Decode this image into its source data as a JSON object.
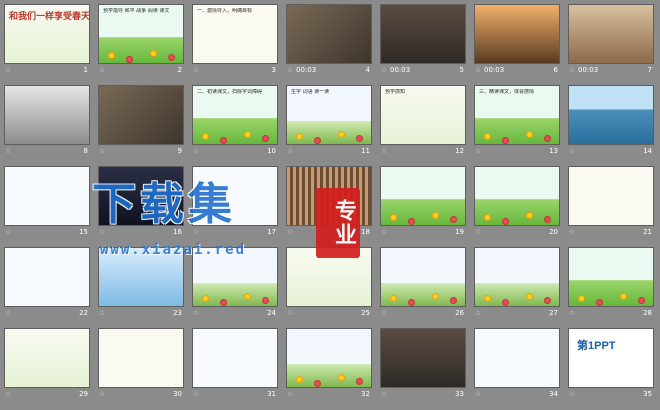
{
  "slides": [
    {
      "n": "1",
      "theme": "t-green",
      "title": "和我们一样享受春天",
      "dur": ""
    },
    {
      "n": "2",
      "theme": "t-grass",
      "text": "预学指导 和平 战争 阅读 课文",
      "dur": ""
    },
    {
      "n": "3",
      "theme": "t-cream",
      "text": "一、激情导入，明确目标",
      "dur": ""
    },
    {
      "n": "4",
      "theme": "t-photo",
      "text": "",
      "dur": "00:03"
    },
    {
      "n": "5",
      "theme": "t-dark",
      "text": "",
      "dur": "00:03"
    },
    {
      "n": "6",
      "theme": "t-dusk",
      "text": "",
      "dur": "00:03"
    },
    {
      "n": "7",
      "theme": "t-brick",
      "text": "",
      "dur": "00:03"
    },
    {
      "n": "8",
      "theme": "t-bw",
      "text": "",
      "dur": ""
    },
    {
      "n": "9",
      "theme": "t-photo",
      "text": "",
      "dur": ""
    },
    {
      "n": "10",
      "theme": "t-grass",
      "text": "二、初读课文，扫除字词障碍",
      "dur": ""
    },
    {
      "n": "11",
      "theme": "t-flower",
      "text": "生字 词语 读一读",
      "dur": ""
    },
    {
      "n": "12",
      "theme": "t-green",
      "text": "预学感知",
      "dur": ""
    },
    {
      "n": "13",
      "theme": "t-grass",
      "text": "三、精读课文，体会感情",
      "dur": ""
    },
    {
      "n": "14",
      "theme": "t-sea",
      "text": "",
      "dur": ""
    },
    {
      "n": "15",
      "theme": "t-white",
      "text": "",
      "dur": ""
    },
    {
      "n": "16",
      "theme": "t-night",
      "text": "",
      "dur": ""
    },
    {
      "n": "17",
      "theme": "t-white",
      "text": "",
      "dur": ""
    },
    {
      "n": "18",
      "theme": "t-crowd",
      "text": "",
      "dur": ""
    },
    {
      "n": "19",
      "theme": "t-grass",
      "text": "",
      "dur": ""
    },
    {
      "n": "20",
      "theme": "t-grass",
      "text": "",
      "dur": ""
    },
    {
      "n": "21",
      "theme": "t-cream",
      "text": "",
      "dur": ""
    },
    {
      "n": "22",
      "theme": "t-white",
      "text": "",
      "dur": ""
    },
    {
      "n": "23",
      "theme": "t-blue",
      "text": "",
      "dur": ""
    },
    {
      "n": "24",
      "theme": "t-flower",
      "text": "",
      "dur": ""
    },
    {
      "n": "25",
      "theme": "t-green",
      "text": "",
      "dur": ""
    },
    {
      "n": "26",
      "theme": "t-flower",
      "text": "",
      "dur": ""
    },
    {
      "n": "27",
      "theme": "t-flower",
      "text": "",
      "dur": ""
    },
    {
      "n": "28",
      "theme": "t-grass",
      "text": "",
      "dur": ""
    },
    {
      "n": "29",
      "theme": "t-green",
      "text": "",
      "dur": ""
    },
    {
      "n": "30",
      "theme": "t-cream",
      "text": "",
      "dur": ""
    },
    {
      "n": "31",
      "theme": "t-white",
      "text": "",
      "dur": ""
    },
    {
      "n": "32",
      "theme": "t-flower",
      "text": "",
      "dur": ""
    },
    {
      "n": "33",
      "theme": "t-dark",
      "text": "",
      "dur": ""
    },
    {
      "n": "34",
      "theme": "t-white",
      "text": "",
      "dur": ""
    },
    {
      "n": "35",
      "theme": "t-ppt",
      "text": "第1PPT",
      "dur": ""
    }
  ],
  "watermark": {
    "main": "下载集",
    "stamp": "专业",
    "url": "www.xiazai.red"
  },
  "icons": {
    "slide_marker": "star-icon"
  }
}
